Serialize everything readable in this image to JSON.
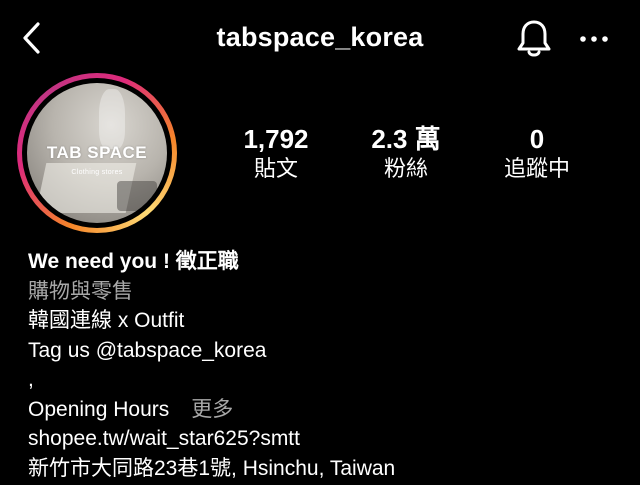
{
  "header": {
    "username": "tabspace_korea"
  },
  "avatar": {
    "title": "TAB SPACE",
    "subtitle": "Clothing stores"
  },
  "stats": {
    "posts_value": "1,792",
    "posts_label": "貼文",
    "followers_value": "2.3 萬",
    "followers_label": "粉絲",
    "following_value": "0",
    "following_label": "追蹤中"
  },
  "bio": {
    "name": "We need you ! 徵正職",
    "category": "購物與零售",
    "line1": "韓國連線 x Outfit",
    "line2": "Tag us @tabspace_korea",
    "line3": ",",
    "line4": "Opening Hours",
    "more_label": "更多",
    "website": "shopee.tw/wait_star625?smtt",
    "address": "新竹市大同路23巷1號, Hsinchu, Taiwan"
  },
  "colors": {
    "background": "#000000",
    "text": "#ffffff",
    "muted": "#a8a8a8",
    "story_ring": [
      "#f58529",
      "#dd2a7b",
      "#feda75"
    ]
  },
  "icons": {
    "back": "chevron-left-icon",
    "notifications": "bell-icon",
    "more": "more-horizontal-icon"
  }
}
